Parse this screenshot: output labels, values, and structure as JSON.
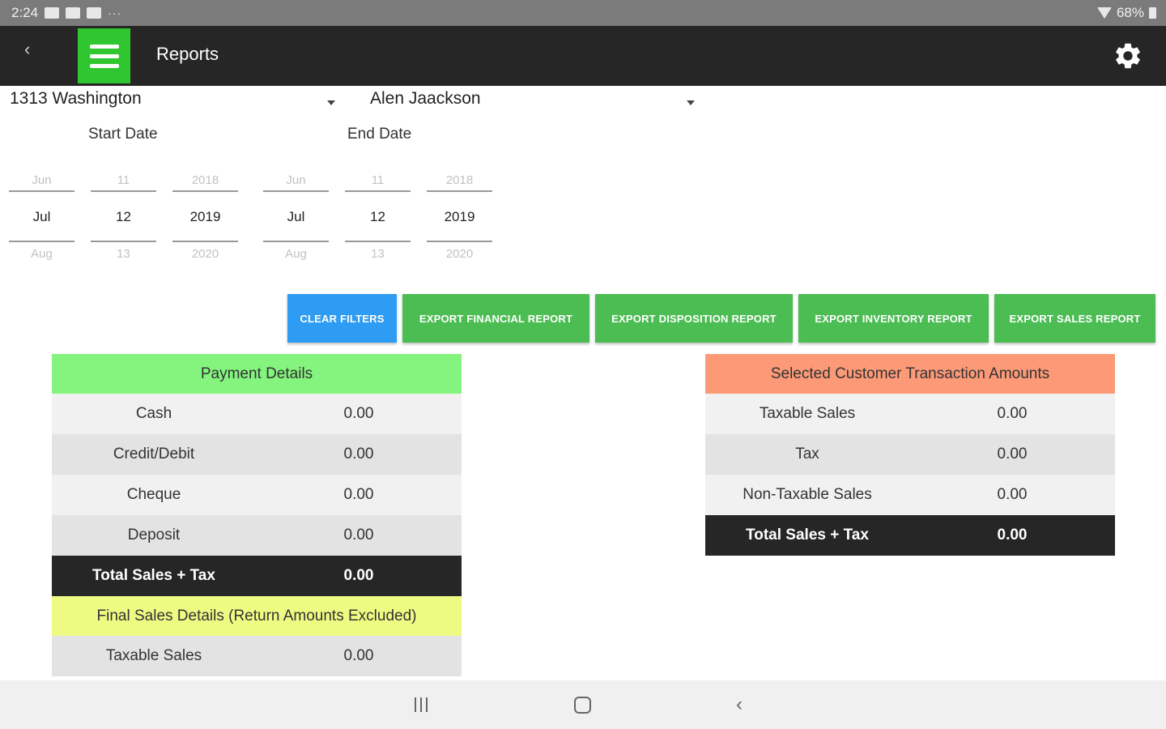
{
  "status_bar": {
    "time": "2:24",
    "dots": "···",
    "battery": "68%"
  },
  "app_bar": {
    "title": "Reports",
    "back_glyph": "‹"
  },
  "filters": {
    "location": "1313 Washington",
    "customer": "Alen Jaackson",
    "start_label": "Start Date",
    "end_label": "End Date"
  },
  "start_date": {
    "month": {
      "prev": "Jun",
      "cur": "Jul",
      "next": "Aug"
    },
    "day": {
      "prev": "11",
      "cur": "12",
      "next": "13"
    },
    "year": {
      "prev": "2018",
      "cur": "2019",
      "next": "2020"
    }
  },
  "end_date": {
    "month": {
      "prev": "Jun",
      "cur": "Jul",
      "next": "Aug"
    },
    "day": {
      "prev": "11",
      "cur": "12",
      "next": "13"
    },
    "year": {
      "prev": "2018",
      "cur": "2019",
      "next": "2020"
    }
  },
  "actions": {
    "clear": "CLEAR FILTERS",
    "financial": "EXPORT FINANCIAL REPORT",
    "disposition": "EXPORT DISPOSITION REPORT",
    "inventory": "EXPORT INVENTORY REPORT",
    "sales": "EXPORT SALES REPORT"
  },
  "payment_details": {
    "title": "Payment Details",
    "rows": [
      {
        "label": "Cash",
        "value": "0.00"
      },
      {
        "label": "Credit/Debit",
        "value": "0.00"
      },
      {
        "label": "Cheque",
        "value": "0.00"
      },
      {
        "label": "Deposit",
        "value": "0.00"
      }
    ],
    "total": {
      "label": "Total Sales + Tax",
      "value": "0.00"
    }
  },
  "final_sales": {
    "title": "Final Sales Details (Return Amounts Excluded)",
    "rows": [
      {
        "label": "Taxable Sales",
        "value": "0.00"
      }
    ]
  },
  "customer_amounts": {
    "title": "Selected Customer Transaction Amounts",
    "rows": [
      {
        "label": "Taxable Sales",
        "value": "0.00"
      },
      {
        "label": "Tax",
        "value": "0.00"
      },
      {
        "label": "Non-Taxable Sales",
        "value": "0.00"
      }
    ],
    "total": {
      "label": "Total Sales + Tax",
      "value": "0.00"
    }
  },
  "colors": {
    "app_bar": "#262626",
    "menu_green": "#2fc62f",
    "button_blue": "#2d9cf2",
    "button_green": "#4cbd53",
    "payment_header": "#84f47e",
    "customer_header": "#fc9a78",
    "final_header": "#eefb82"
  },
  "icons": [
    "image-icon",
    "gallery-icon",
    "youtube-icon",
    "wifi-icon",
    "battery-icon",
    "back-icon",
    "menu-icon",
    "gear-icon",
    "dropdown-caret-icon"
  ]
}
